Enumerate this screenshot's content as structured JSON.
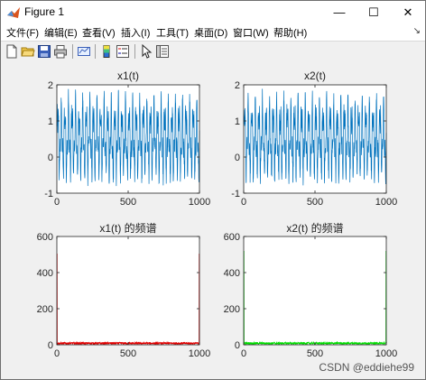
{
  "window": {
    "title": "Figure 1",
    "minimize_glyph": "—",
    "maximize_glyph": "☐",
    "close_glyph": "✕"
  },
  "menu": {
    "items": [
      "文件(F)",
      "编辑(E)",
      "查看(V)",
      "插入(I)",
      "工具(T)",
      "桌面(D)",
      "窗口(W)",
      "帮助(H)"
    ],
    "overflow_glyph": "↘"
  },
  "toolbar": {
    "icons": [
      "new-figure-icon",
      "open-file-icon",
      "save-icon",
      "print-icon",
      "link-plot-icon",
      "colorbar-icon",
      "legend-icon",
      "pointer-icon",
      "property-inspector-icon"
    ]
  },
  "colors": {
    "line_blue": "#0072BD",
    "spectrum_red": "#e00000",
    "spectrum_green": "#00dd00"
  },
  "chart_data": [
    {
      "type": "line",
      "title": "x1(t)",
      "x_range": [
        0,
        1000
      ],
      "ylim": [
        -1,
        2
      ],
      "xticks": [
        0,
        500,
        1000
      ],
      "yticks": [
        -1,
        0,
        1,
        2
      ],
      "series": [
        {
          "color": "#0072BD",
          "description": "sum of two sinusoids plus noise, oscillating roughly between -0.9 and 1.9, about 40 cycles"
        }
      ],
      "signal_model": {
        "offset": 0.5,
        "amp1": 0.75,
        "cycles1": 40,
        "amp2": 0.45,
        "cycles2": 100,
        "noise": 0.22
      }
    },
    {
      "type": "line",
      "title": "x2(t)",
      "x_range": [
        0,
        1000
      ],
      "ylim": [
        -1,
        2
      ],
      "xticks": [
        0,
        500,
        1000
      ],
      "yticks": [
        -1,
        0,
        1,
        2
      ],
      "series": [
        {
          "color": "#0072BD",
          "description": "sum of two sinusoids plus noise, oscillating roughly between -0.9 and 1.9, about 40 cycles"
        }
      ],
      "signal_model": {
        "offset": 0.5,
        "amp1": 0.75,
        "cycles1": 40,
        "amp2": 0.45,
        "cycles2": 100,
        "noise": 0.22
      }
    },
    {
      "type": "line",
      "title": "x1(t) 的频谱",
      "x_range": [
        0,
        1000
      ],
      "ylim": [
        0,
        600
      ],
      "xticks": [
        0,
        500,
        1000
      ],
      "yticks": [
        0,
        200,
        400,
        600
      ],
      "series": [
        {
          "color": "#e00000",
          "peaks": [
            {
              "x": 0,
              "y": 505
            },
            {
              "x": 1000,
              "y": 505
            }
          ],
          "noise_floor": 8
        }
      ]
    },
    {
      "type": "line",
      "title": "x2(t) 的频谱",
      "x_range": [
        0,
        1000
      ],
      "ylim": [
        0,
        600
      ],
      "xticks": [
        0,
        500,
        1000
      ],
      "yticks": [
        0,
        200,
        400,
        600
      ],
      "series": [
        {
          "color": "#00dd00",
          "peaks": [
            {
              "x": 0,
              "y": 520
            },
            {
              "x": 1000,
              "y": 520
            }
          ],
          "noise_floor": 8
        }
      ]
    }
  ],
  "watermark": "CSDN @eddiehe99"
}
